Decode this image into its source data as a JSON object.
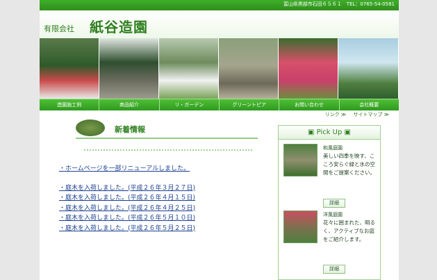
{
  "header": {
    "address": "富山県黒部市石田６５６１　TEL：0765-54-0581",
    "company_type": "有限会社",
    "company_name": "紙谷造園"
  },
  "photos": [
    "garden-photo-1",
    "garden-photo-2",
    "garden-photo-3",
    "garden-photo-4",
    "garden-photo-5",
    "garden-photo-6"
  ],
  "nav": [
    "造園施工例",
    "商品紹介",
    "リ・ガーデン",
    "グリーントピア",
    "お問い合わせ",
    "会社概要"
  ],
  "sublinks": [
    "リンク ≫",
    "サイトマップ ≫"
  ],
  "news": {
    "title": "新着情報",
    "items": [
      "・ホームページを一部リニューアルしました。",
      "・庭木を入荷しました。(平成２６年３月２７日)",
      "・庭木を入荷しました。(平成２６年４月１５日)",
      "・庭木を入荷しました。(平成２６年４月２５日)",
      "・庭木を入荷しました。(平成２６年５月１０日)",
      "・庭木を入荷しました。(平成２６年５月２５日)"
    ]
  },
  "pickup": {
    "title": "▣ Pick Up ▣",
    "items": [
      {
        "name": "和風庭園",
        "desc": "美しい四季を映す、こころ安らぐ緑と水の空間をご提案ください。",
        "button": "詳細"
      },
      {
        "name": "洋風庭園",
        "desc": "花々に囲まれた、明るく、アクティブなお庭をご紹介します。",
        "button": "詳細"
      }
    ]
  }
}
